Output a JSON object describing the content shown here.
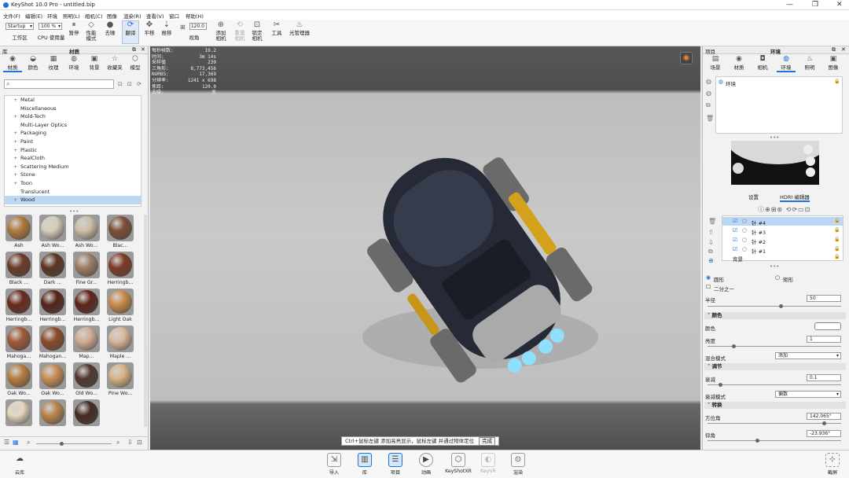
{
  "app_title": "KeyShot 10.0 Pro  - untitled.bip",
  "window_controls": [
    "—",
    "❐",
    "✕"
  ],
  "menu": [
    "文件(F)",
    "编辑(E)",
    "环境",
    "照明(L)",
    "相机(C)",
    "图像",
    "渲染(R)",
    "查看(V)",
    "窗口",
    "帮助(H)"
  ],
  "toolbar": {
    "workspace_value": "Startup",
    "workspace_label": "工作区",
    "cpu_value": "100 %",
    "cpu_label": "CPU 使用量",
    "pause_label": "暂停",
    "perf_label": "性能\n模式",
    "denoise_label": "去噪",
    "refresh_label": "翻译",
    "pan_label": "平移",
    "push_label": "推移",
    "fov_value": "120.0",
    "fov_label": "视角",
    "add_camera": "添加\n相机",
    "reset_camera": "重置\n相机",
    "lock_camera": "锁定\n相机",
    "tools_label": "工具",
    "light_manager": "光管理器"
  },
  "library": {
    "panel_title": "库",
    "panel_sub": "材质",
    "tabs": [
      "材质",
      "颜色",
      "纹理",
      "环境",
      "背景",
      "收藏夹",
      "模型"
    ],
    "tree": [
      "Metal",
      "Miscellaneous",
      "Mold-Tech",
      "Multi-Layer Optics",
      "Packaging",
      "Paint",
      "Plastic",
      "RealCloth",
      "Scattering Medium",
      "Stone",
      "Toon",
      "Translucent",
      "Wood"
    ],
    "materials": [
      "Ash",
      "Ash Wo...",
      "Ash Wo...",
      "Blac...",
      "Black ...",
      "Dark ...",
      "Fine Gr...",
      "Herringb...",
      "Herringb...",
      "Herringb...",
      "Herringb...",
      "Light Oak",
      "Mahoga...",
      "Mahogan...",
      "Map...",
      "Maple ...",
      "Oak Wo...",
      "Oak Wo...",
      "Old Wo...",
      "Pine Wo...",
      "",
      "",
      ""
    ]
  },
  "stats": [
    [
      "每秒帧数:",
      "19.2"
    ],
    [
      "时间:",
      "3m 14s"
    ],
    [
      "采样值",
      "239"
    ],
    [
      "三角形:",
      "8,773,456"
    ],
    [
      "NURBS:",
      "17,369"
    ],
    [
      "分辨率:",
      "1241 x 698"
    ],
    [
      "焦距:",
      "120.0"
    ],
    [
      "去噪:",
      "关"
    ]
  ],
  "hint": {
    "text": "Ctrl+鼠标左键 添加高亮显示，鼠标左键 并通过物体定位",
    "done": "完成"
  },
  "project": {
    "panel_title": "项目",
    "panel_sub": "环境",
    "tabs": [
      "场景",
      "材质",
      "相机",
      "环境",
      "照明",
      "图像"
    ],
    "env_item": "环境",
    "subtabs": [
      "设置",
      "HDRI 编辑器"
    ],
    "pins": [
      "针 #4",
      "针 #3",
      "针 #2",
      "针 #1",
      "背景"
    ],
    "shape_circle": "圆形",
    "shape_rect": "矩形",
    "half": "二分之一",
    "radius_label": "半径",
    "radius_value": "50",
    "sec_color": "颜色",
    "color_label": "颜色",
    "brightness_label": "亮度",
    "brightness_value": "1",
    "blend_label": "混合模式",
    "blend_value": "添加",
    "sec_adjust": "调节",
    "falloff_label": "衰减",
    "falloff_value": "0.1",
    "falloff_mode_label": "衰减模式",
    "falloff_mode_value": "偏数",
    "sec_transform": "转换",
    "azimuth_label": "方位角",
    "azimuth_value": "142.065°",
    "elev_label": "仰角",
    "elev_value": "-23.936°"
  },
  "bottom": {
    "cloud": "云库",
    "import": "导入",
    "library": "库",
    "project": "项目",
    "animation": "动画",
    "keyshotxr": "KeyShotXR",
    "keyvr": "KeyVR",
    "render": "渲染",
    "expert": "截屏"
  },
  "colors": {
    "accent": "#1c73d9"
  }
}
